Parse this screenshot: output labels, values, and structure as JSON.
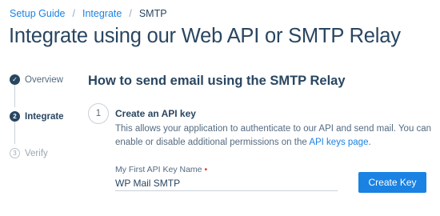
{
  "breadcrumb": {
    "items": [
      "Setup Guide",
      "Integrate",
      "SMTP"
    ],
    "separator": "/"
  },
  "page": {
    "title": "Integrate using our Web API or SMTP Relay"
  },
  "steps": [
    {
      "label": "Overview",
      "status": "complete",
      "marker": "✓"
    },
    {
      "label": "Integrate",
      "status": "active",
      "marker": "2"
    },
    {
      "label": "Verify",
      "status": "pending",
      "marker": "3"
    }
  ],
  "section": {
    "title": "How to send email using the SMTP Relay"
  },
  "substep": {
    "number": "1",
    "title": "Create an API key",
    "description_before": "This allows your application to authenticate to our API and send mail. You can enable or disable additional permissions on the ",
    "description_link": "API keys page",
    "description_after": "."
  },
  "form": {
    "label": "My First API Key Name",
    "required_mark": "•",
    "value": "WP Mail SMTP",
    "button_label": "Create Key"
  },
  "colors": {
    "primary": "#1a82e2",
    "text": "#294661",
    "muted": "#546b81",
    "required": "#e3332b"
  }
}
